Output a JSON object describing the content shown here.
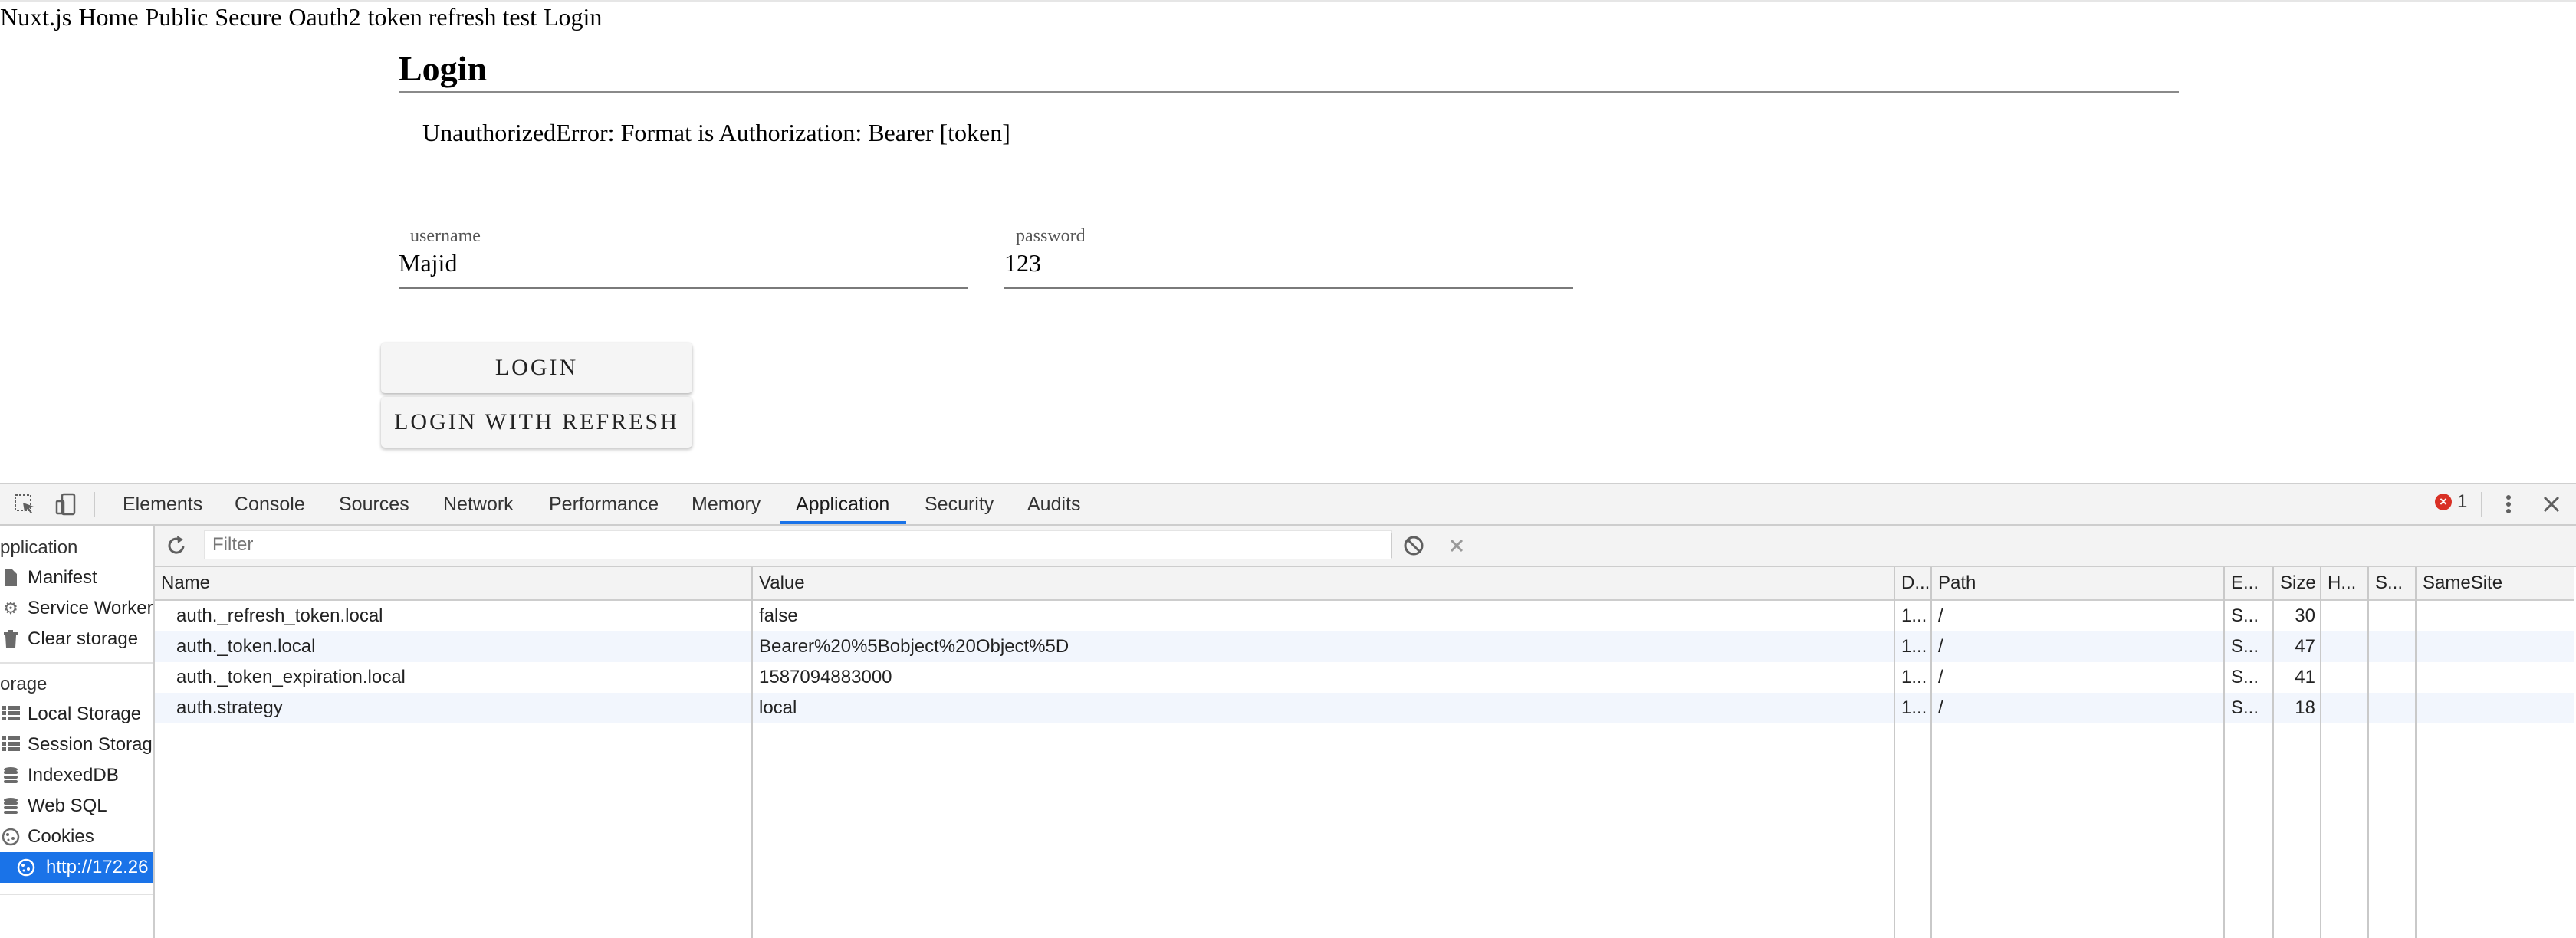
{
  "page": {
    "nav": [
      "Nuxt.js",
      "Home",
      "Public",
      "Secure",
      "Oauth2",
      "token refresh test",
      "Login"
    ],
    "title": "Login",
    "error": "UnauthorizedError: Format is Authorization: Bearer [token]",
    "username": {
      "label": "username",
      "value": "Majid"
    },
    "password": {
      "label": "password",
      "value": "123"
    },
    "login_button": "LOGIN",
    "login_refresh_button": "LOGIN WITH REFRESH"
  },
  "devtools": {
    "tabs": [
      "Elements",
      "Console",
      "Sources",
      "Network",
      "Performance",
      "Memory",
      "Application",
      "Security",
      "Audits"
    ],
    "active_tab": "Application",
    "error_count": "1",
    "sidebar": {
      "application_header": "pplication",
      "application_items": [
        {
          "label": "Manifest",
          "icon": "file-icon"
        },
        {
          "label": "Service Workers",
          "icon": "gear-icon"
        },
        {
          "label": "Clear storage",
          "icon": "trash-icon"
        }
      ],
      "storage_header": "orage",
      "storage_items": [
        {
          "label": "Local Storage",
          "icon": "grid-icon"
        },
        {
          "label": "Session Storage",
          "icon": "grid-icon"
        },
        {
          "label": "IndexedDB",
          "icon": "database-icon"
        },
        {
          "label": "Web SQL",
          "icon": "database-icon"
        },
        {
          "label": "Cookies",
          "icon": "cookie-icon"
        }
      ],
      "selected_item": {
        "label": "http://172.26",
        "icon": "cookie-icon"
      }
    },
    "filter_placeholder": "Filter",
    "table": {
      "columns": [
        "Name",
        "Value",
        "D...",
        "Path",
        "E...",
        "Size",
        "H...",
        "S...",
        "SameSite"
      ],
      "rows": [
        [
          "auth._refresh_token.local",
          "false",
          "1...",
          "/",
          "S...",
          "30",
          "",
          "",
          ""
        ],
        [
          "auth._token.local",
          "Bearer%20%5Bobject%20Object%5D",
          "1...",
          "/",
          "S...",
          "47",
          "",
          "",
          ""
        ],
        [
          "auth._token_expiration.local",
          "1587094883000",
          "1...",
          "/",
          "S...",
          "41",
          "",
          "",
          ""
        ],
        [
          "auth.strategy",
          "local",
          "1...",
          "/",
          "S...",
          "18",
          "",
          "",
          ""
        ]
      ]
    },
    "colors": {
      "accent": "#1a73e8",
      "error": "#d93025",
      "row_alt": "#f2f6fd"
    }
  }
}
